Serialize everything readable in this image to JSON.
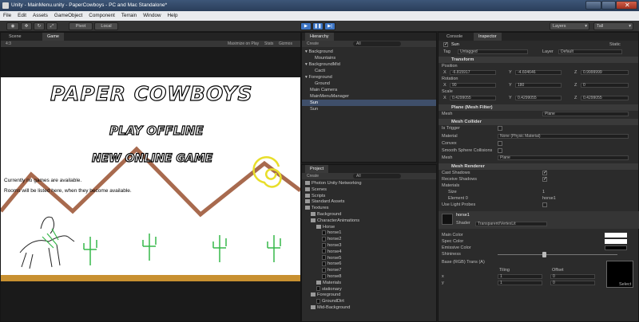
{
  "window": {
    "title": "Unity - MainMenu.unity - PaperCowboys - PC and Mac Standalone*"
  },
  "menu": [
    "File",
    "Edit",
    "Assets",
    "GameObject",
    "Component",
    "Terrain",
    "Window",
    "Help"
  ],
  "toolbar": {
    "pivot": "Pivot",
    "local": "Local",
    "layers": "Layers",
    "layout": "Tall"
  },
  "scene": {
    "scene_tab": "Scene",
    "game_tab": "Game",
    "aspect": "4:3",
    "maximize": "Maximize on Play",
    "stats": "Stats",
    "gizmos": "Gizmos"
  },
  "game": {
    "logo": "PAPER COWBOYS",
    "play_offline": "PLAY OFFLINE",
    "new_online_game": "NEW ONLINE GAME",
    "msg1": "Currently no games are available.",
    "msg2": "Rooms will be listed here, when they become available."
  },
  "hierarchy": {
    "tab": "Hierarchy",
    "create": "Create",
    "search": "All",
    "items": [
      {
        "label": "Background",
        "indent": 0,
        "arrow": true,
        "sel": false
      },
      {
        "label": "Mountains",
        "indent": 2,
        "arrow": false,
        "sel": false
      },
      {
        "label": "BackgroundMid",
        "indent": 0,
        "arrow": true,
        "sel": false
      },
      {
        "label": "Cacti",
        "indent": 2,
        "arrow": false,
        "sel": false
      },
      {
        "label": "Foreground",
        "indent": 0,
        "arrow": true,
        "sel": false
      },
      {
        "label": "Ground",
        "indent": 2,
        "arrow": false,
        "sel": false
      },
      {
        "label": "Main Camera",
        "indent": 1,
        "arrow": false,
        "sel": false
      },
      {
        "label": "MainMenuManager",
        "indent": 1,
        "arrow": false,
        "sel": false
      },
      {
        "label": "Sun",
        "indent": 1,
        "arrow": false,
        "sel": true
      },
      {
        "label": "Sun",
        "indent": 1,
        "arrow": false,
        "sel": false
      }
    ]
  },
  "project": {
    "tab": "Project",
    "create": "Create",
    "search": "All",
    "items": [
      {
        "label": "Photon Unity Networking",
        "indent": 0,
        "kind": "folder"
      },
      {
        "label": "Scenes",
        "indent": 0,
        "kind": "folder"
      },
      {
        "label": "Scripts",
        "indent": 0,
        "kind": "folder"
      },
      {
        "label": "Standard Assets",
        "indent": 0,
        "kind": "folder"
      },
      {
        "label": "Textures",
        "indent": 0,
        "kind": "folder"
      },
      {
        "label": "Background",
        "indent": 1,
        "kind": "folder"
      },
      {
        "label": "CharacterAnimations",
        "indent": 1,
        "kind": "folder"
      },
      {
        "label": "Horse",
        "indent": 2,
        "kind": "folder"
      },
      {
        "label": "horse1",
        "indent": 3,
        "kind": "thumb"
      },
      {
        "label": "horse2",
        "indent": 3,
        "kind": "thumb"
      },
      {
        "label": "horse3",
        "indent": 3,
        "kind": "thumb"
      },
      {
        "label": "horse4",
        "indent": 3,
        "kind": "thumb"
      },
      {
        "label": "horse5",
        "indent": 3,
        "kind": "thumb"
      },
      {
        "label": "horse6",
        "indent": 3,
        "kind": "thumb"
      },
      {
        "label": "horse7",
        "indent": 3,
        "kind": "thumb"
      },
      {
        "label": "horse8",
        "indent": 3,
        "kind": "thumb"
      },
      {
        "label": "Materials",
        "indent": 2,
        "kind": "folder"
      },
      {
        "label": "stationary",
        "indent": 2,
        "kind": "thumb"
      },
      {
        "label": "Foreground",
        "indent": 1,
        "kind": "folder"
      },
      {
        "label": "GroundDirt",
        "indent": 2,
        "kind": "thumb"
      },
      {
        "label": "Mid-Background",
        "indent": 1,
        "kind": "folder"
      }
    ]
  },
  "inspector": {
    "console_tab": "Console",
    "inspector_tab": "Inspector",
    "object_name": "Sun",
    "static_label": "Static",
    "tag_label": "Tag",
    "tag": "Untagged",
    "layer_label": "Layer",
    "layer": "Default",
    "transform": {
      "title": "Transform",
      "position_label": "Position",
      "position": {
        "x": "-6.815917",
        "y": "-4.604646",
        "z": "0.9999999"
      },
      "rotation_label": "Rotation",
      "rotation": {
        "x": "90",
        "y": "180",
        "z": "0"
      },
      "scale_label": "Scale",
      "scale": {
        "x": "0.4299055",
        "y": "0.4299055",
        "z": "0.4299055"
      }
    },
    "mesh_filter": {
      "title": "Plane (Mesh Filter)",
      "mesh_label": "Mesh",
      "mesh": "Plane"
    },
    "mesh_collider": {
      "title": "Mesh Collider",
      "is_trigger": "Is Trigger",
      "material_label": "Material",
      "material": "None (Physic Material)",
      "convex": "Convex",
      "smooth": "Smooth Sphere Collisions",
      "mesh_label": "Mesh",
      "mesh": "Plane"
    },
    "mesh_renderer": {
      "title": "Mesh Renderer",
      "cast": "Cast Shadows",
      "receive": "Receive Shadows",
      "materials": "Materials",
      "size_label": "Size",
      "size": "1",
      "element_label": "Element 0",
      "element": "horse1",
      "light_probes": "Use Light Probes"
    },
    "material": {
      "name": "horse1",
      "shader_label": "Shader",
      "shader": "Transparent/VertexLit",
      "main_color": "Main Color",
      "spec_color": "Spec Color",
      "emissive_color": "Emissive Color",
      "shininess": "Shininess",
      "base": "Base (RGB) Trans (A)",
      "tiling": "Tiling",
      "offset": "Offset",
      "tx": "1",
      "ty": "1",
      "ox": "0",
      "oy": "0",
      "select": "Select"
    }
  }
}
